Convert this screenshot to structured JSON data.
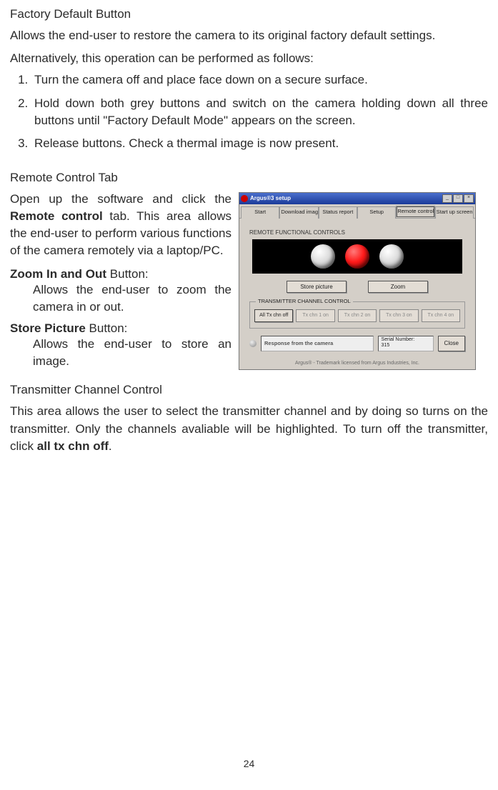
{
  "page_number": "24",
  "section1": {
    "heading": "Factory Default Button",
    "intro1": "Allows the end-user to restore the camera to its original factory default settings.",
    "intro2": "Alternatively, this operation can be performed as follows:",
    "steps": [
      "Turn the camera off and place face down on a secure surface.",
      "Hold down both grey buttons and switch on the camera holding down all three buttons until \"Factory Default Mode\" appears on the screen.",
      "Release buttons.  Check a thermal image is now present."
    ]
  },
  "section2": {
    "heading": "Remote Control Tab",
    "para_pre": "Open up the software and click the ",
    "para_bold": "Remote control",
    "para_post": " tab. This area allows the end-user to perform various functions of the camera remotely via a laptop/PC.",
    "defs": [
      {
        "term_bold": "Zoom In and Out",
        "term_rest": " Button:",
        "body": "Allows the end-user to zoom the camera in or out."
      },
      {
        "term_bold": "Store Picture",
        "term_rest": " Button:",
        "body": "Allows the end-user to store an image."
      }
    ]
  },
  "section3": {
    "heading": "Transmitter Channel Control",
    "para_pre": "This area allows the user to select the transmitter channel and by doing so turns on the transmitter. Only the channels avaliable will be highlighted. To turn off the transmitter, click ",
    "para_bold": "all tx chn off",
    "para_post": "."
  },
  "ui": {
    "title": "Argus®3 setup",
    "tabs": [
      "Start",
      "Download image",
      "Status report",
      "Setup",
      "Remote control",
      "Start up screen"
    ],
    "section_label": "REMOTE FUNCTIONAL CONTROLS",
    "store_btn": "Store picture",
    "zoom_btn": "Zoom",
    "group_legend": "TRANSMITTER CHANNEL CONTROL",
    "chn": [
      "All Tx chn off",
      "Tx chn 1 on",
      "Tx chn 2 on",
      "Tx chn 3 on",
      "Tx chn 4 on"
    ],
    "response_label": "Response from the camera",
    "serial_label": "Serial Number:",
    "serial_value": "315",
    "close_btn": "Close",
    "trademark": "Argus® - Trademark licensed from Argus Industries, Inc."
  }
}
